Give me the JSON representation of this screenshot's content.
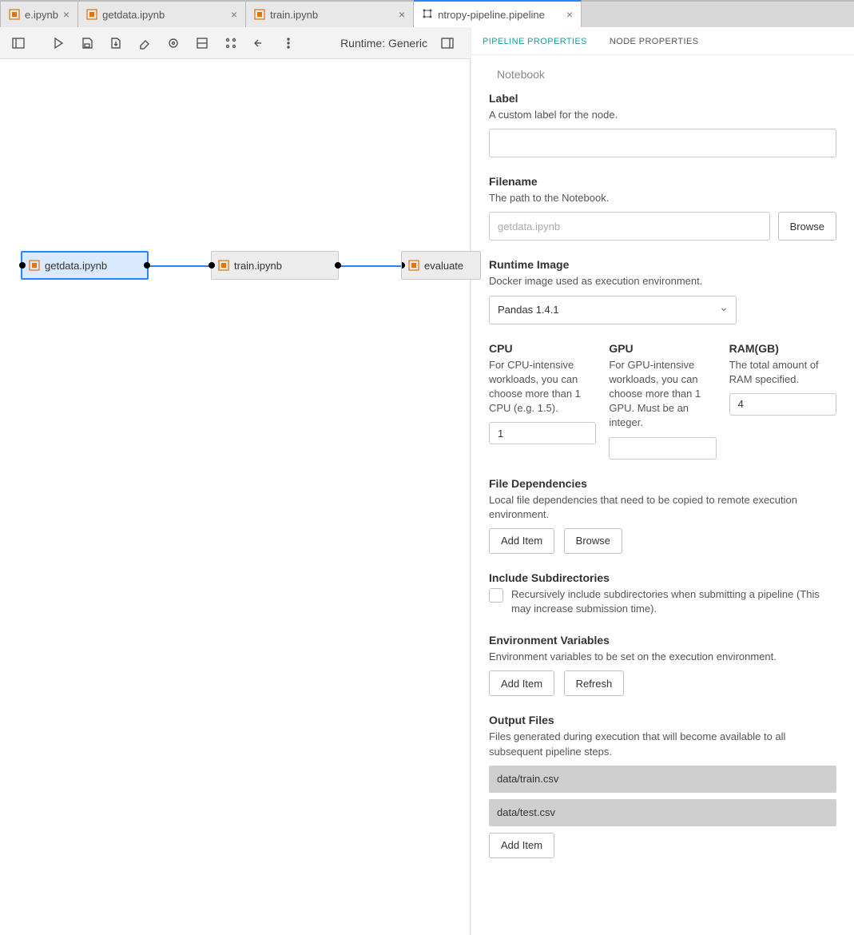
{
  "tabs": [
    {
      "label": "e.ipynb",
      "kind": "notebook"
    },
    {
      "label": "getdata.ipynb",
      "kind": "notebook"
    },
    {
      "label": "train.ipynb",
      "kind": "notebook"
    },
    {
      "label": "ntropy-pipeline.pipeline",
      "kind": "pipeline",
      "active": true
    }
  ],
  "toolbar": {
    "runtime_label": "Runtime: Generic"
  },
  "nodes": [
    {
      "label": "getdata.ipynb",
      "selected": true
    },
    {
      "label": "train.ipynb",
      "selected": false
    },
    {
      "label": "evaluate",
      "selected": false
    }
  ],
  "panel": {
    "tab_pipeline": "PIPELINE PROPERTIES",
    "tab_node": "NODE PROPERTIES",
    "breadcrumb": "Notebook",
    "label": {
      "title": "Label",
      "desc": "A custom label for the node.",
      "value": ""
    },
    "filename": {
      "title": "Filename",
      "desc": "The path to the Notebook.",
      "placeholder": "getdata.ipynb",
      "browse": "Browse"
    },
    "runtime": {
      "title": "Runtime Image",
      "desc": "Docker image used as execution environment.",
      "value": "Pandas 1.4.1"
    },
    "cpu": {
      "title": "CPU",
      "desc": "For CPU-intensive workloads, you can choose more than 1 CPU (e.g. 1.5).",
      "value": "1"
    },
    "gpu": {
      "title": "GPU",
      "desc": "For GPU-intensive workloads, you can choose more than 1 GPU. Must be an integer.",
      "value": ""
    },
    "ram": {
      "title": "RAM(GB)",
      "desc": "The total amount of RAM specified.",
      "value": "4"
    },
    "filedeps": {
      "title": "File Dependencies",
      "desc": "Local file dependencies that need to be copied to remote execution environment.",
      "add": "Add Item",
      "browse": "Browse"
    },
    "subdirs": {
      "title": "Include Subdirectories",
      "desc": "Recursively include subdirectories when submitting a pipeline (This may increase submission time)."
    },
    "envvars": {
      "title": "Environment Variables",
      "desc": "Environment variables to be set on the execution environment.",
      "add": "Add Item",
      "refresh": "Refresh"
    },
    "outputs": {
      "title": "Output Files",
      "desc": "Files generated during execution that will become available to all subsequent pipeline steps.",
      "items": [
        "data/train.csv",
        "data/test.csv"
      ],
      "add": "Add Item"
    }
  }
}
